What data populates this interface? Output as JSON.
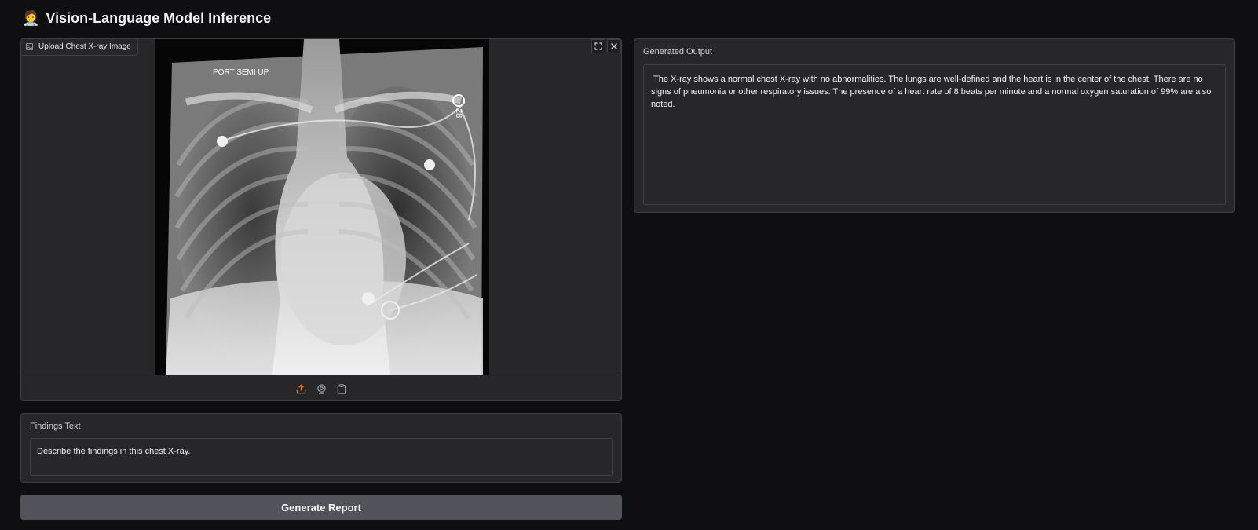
{
  "app": {
    "title": "Vision-Language Model Inference",
    "title_icon": "🧑‍⚕️"
  },
  "image_input": {
    "label": "Upload Chest X-ray Image",
    "image_text": "PORT SEMI UP",
    "toolbar_icons": [
      "upload-icon",
      "webcam-icon",
      "clipboard-icon"
    ],
    "accent_color": "#f97316"
  },
  "findings": {
    "label": "Findings Text",
    "value": "Describe the findings in this chest X-ray."
  },
  "generate": {
    "label": "Generate Report"
  },
  "output": {
    "label": "Generated Output",
    "text": " The X-ray shows a normal chest X-ray with no abnormalities. The lungs are well-defined and the heart is in the center of the chest. There are no signs of pneumonia or other respiratory issues. The presence of a heart rate of 8 beats per minute and a normal oxygen saturation of 99% are also noted."
  }
}
